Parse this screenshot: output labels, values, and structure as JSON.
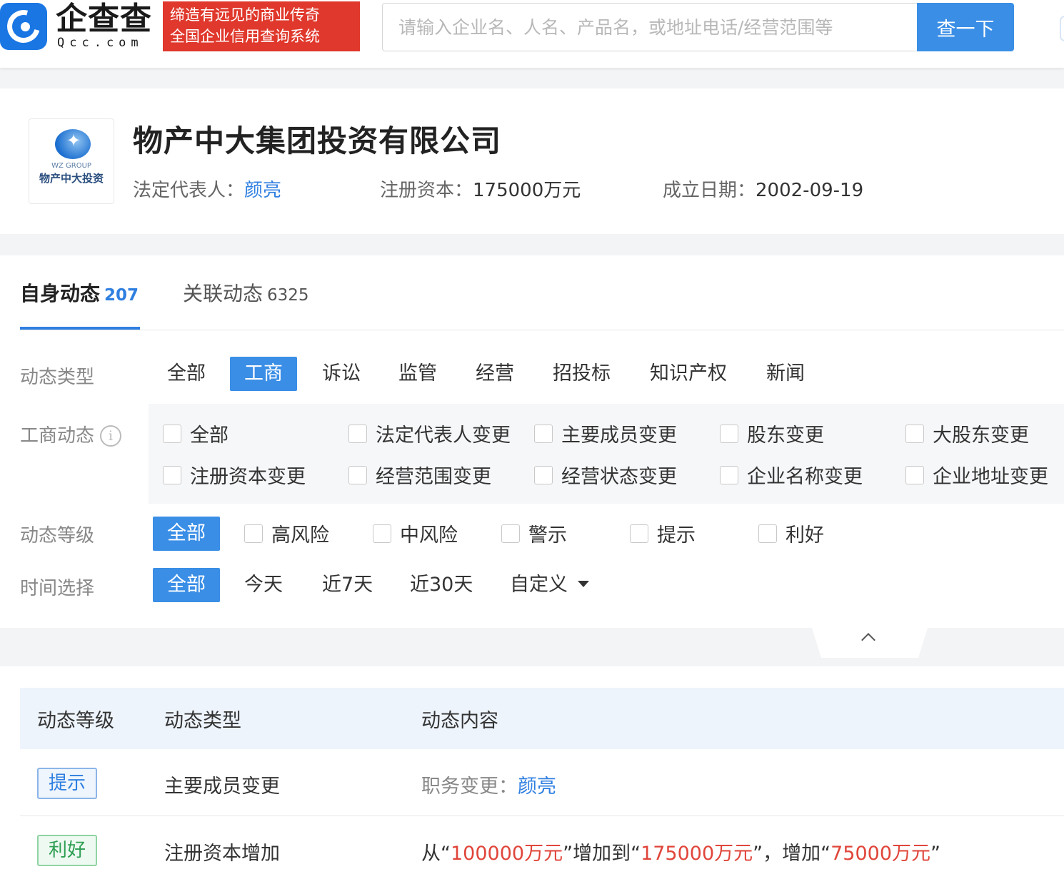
{
  "header": {
    "logo_text": "企查查",
    "logo_domain": "Qcc.com",
    "slogan_line1": "缔造有远见的商业传奇",
    "slogan_line2": "全国企业信用查询系统",
    "search_placeholder": "请输入企业名、人名、产品名，或地址电话/经营范围等",
    "search_button": "查一下"
  },
  "company": {
    "name": "物产中大集团投资有限公司",
    "logo_en": "WZ GROUP",
    "logo_cn": "物产中大投资",
    "legal_rep_label": "法定代表人：",
    "legal_rep": "颜亮",
    "capital_label": "注册资本：",
    "capital": "175000万元",
    "founded_label": "成立日期：",
    "founded": "2002-09-19"
  },
  "tabs": [
    {
      "label": "自身动态",
      "count": "207"
    },
    {
      "label": "关联动态",
      "count": "6325"
    }
  ],
  "filters": {
    "type_label": "动态类型",
    "types": [
      "全部",
      "工商",
      "诉讼",
      "监管",
      "经营",
      "招投标",
      "知识产权",
      "新闻"
    ],
    "types_selected": "工商",
    "biz_label": "工商动态",
    "biz_options": [
      "全部",
      "法定代表人变更",
      "主要成员变更",
      "股东变更",
      "大股东变更",
      "注册资本变更",
      "经营范围变更",
      "经营状态变更",
      "企业名称变更",
      "企业地址变更"
    ],
    "level_label": "动态等级",
    "level_all": "全部",
    "levels": [
      "高风险",
      "中风险",
      "警示",
      "提示",
      "利好"
    ],
    "time_label": "时间选择",
    "time_options": [
      "全部",
      "今天",
      "近7天",
      "近30天",
      "自定义"
    ]
  },
  "table": {
    "headers": [
      "动态等级",
      "动态类型",
      "动态内容"
    ],
    "rows": [
      {
        "level": "提示",
        "type": "主要成员变更",
        "content_prefix": "职务变更：",
        "content_link": "颜亮"
      },
      {
        "level": "利好",
        "type": "注册资本增加",
        "c1": "从“",
        "from": "100000万元",
        "c2": "”增加到“",
        "to": "175000万元",
        "c3": "”，增加“",
        "delta": "75000万元",
        "c4": "”"
      }
    ]
  },
  "colors": {
    "brand_blue": "#3a8ee6",
    "slogan_red": "#e0382c",
    "link_blue": "#2f7fe0",
    "value_red": "#e0453a"
  }
}
